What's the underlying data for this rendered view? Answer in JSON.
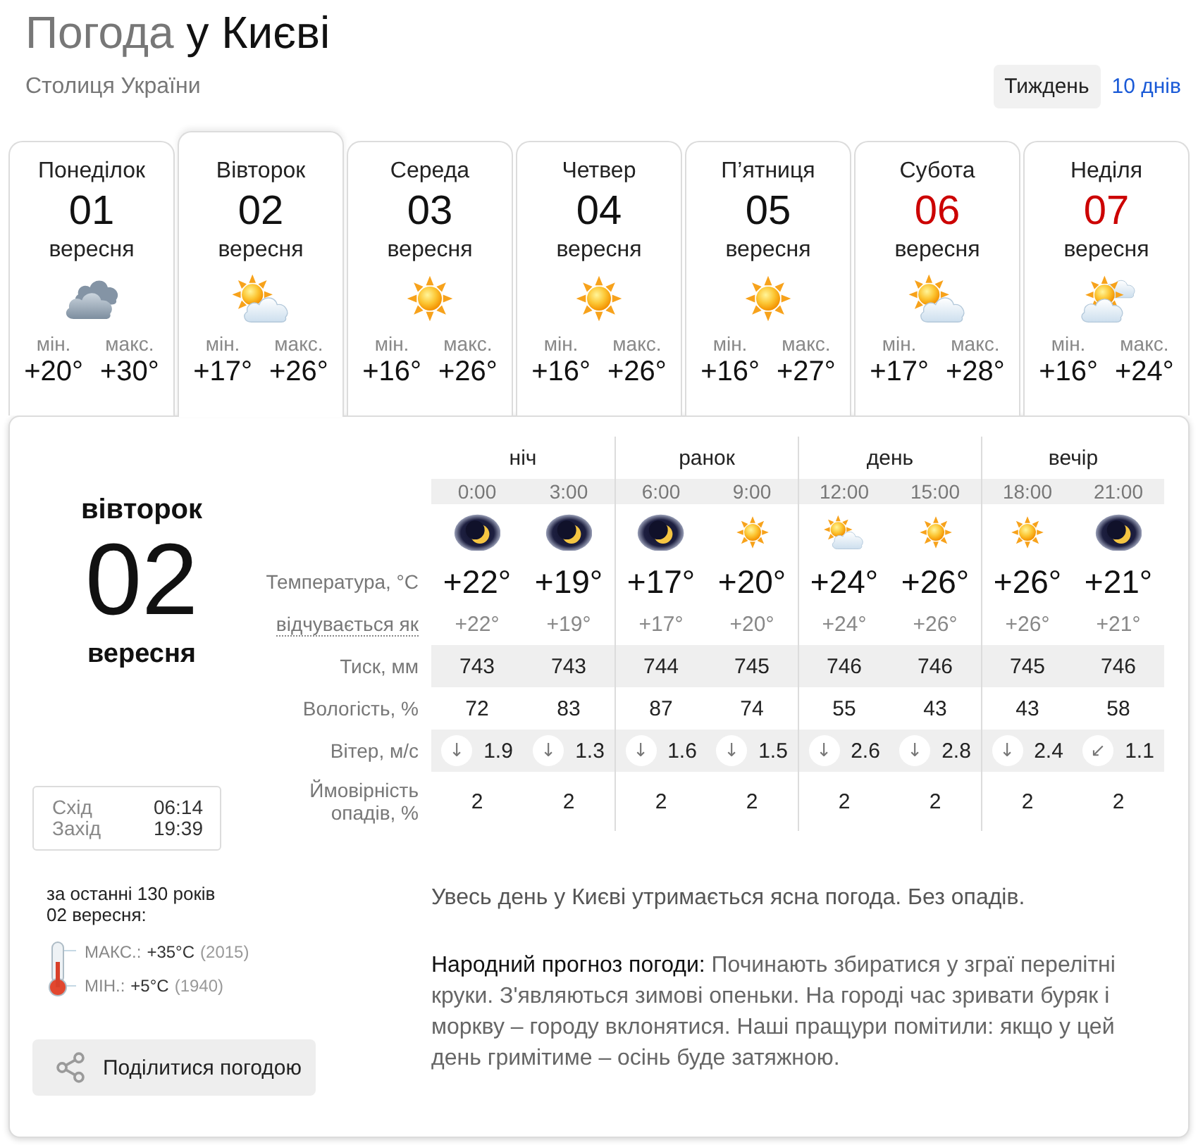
{
  "header": {
    "title_muted": "Погода",
    "title": "у Києві",
    "subtitle": "Столиця України",
    "views": [
      {
        "label": "Тиждень",
        "selected": true
      },
      {
        "label": "10 днів",
        "selected": false
      }
    ]
  },
  "days": [
    {
      "weekday": "Понеділок",
      "date": "01",
      "month": "вересня",
      "kind": "cloudy",
      "weekend": false,
      "selected": false,
      "min_label": "мін.",
      "min": "+20°",
      "max_label": "макс.",
      "max": "+30°"
    },
    {
      "weekday": "Вівторок",
      "date": "02",
      "month": "вересня",
      "kind": "partly-cloudy",
      "weekend": false,
      "selected": true,
      "min_label": "мін.",
      "min": "+17°",
      "max_label": "макс.",
      "max": "+26°"
    },
    {
      "weekday": "Середа",
      "date": "03",
      "month": "вересня",
      "kind": "sunny",
      "weekend": false,
      "selected": false,
      "min_label": "мін.",
      "min": "+16°",
      "max_label": "макс.",
      "max": "+26°"
    },
    {
      "weekday": "Четвер",
      "date": "04",
      "month": "вересня",
      "kind": "sunny",
      "weekend": false,
      "selected": false,
      "min_label": "мін.",
      "min": "+16°",
      "max_label": "макс.",
      "max": "+26°"
    },
    {
      "weekday": "П’ятниця",
      "date": "05",
      "month": "вересня",
      "kind": "sunny",
      "weekend": false,
      "selected": false,
      "min_label": "мін.",
      "min": "+16°",
      "max_label": "макс.",
      "max": "+27°"
    },
    {
      "weekday": "Субота",
      "date": "06",
      "month": "вересня",
      "kind": "partly-cloudy",
      "weekend": true,
      "selected": false,
      "min_label": "мін.",
      "min": "+17°",
      "max_label": "макс.",
      "max": "+28°"
    },
    {
      "weekday": "Неділя",
      "date": "07",
      "month": "вересня",
      "kind": "variable-cloudy",
      "weekend": true,
      "selected": false,
      "min_label": "мін.",
      "min": "+16°",
      "max_label": "макс.",
      "max": "+24°"
    }
  ],
  "detail": {
    "weekday": "вівторок",
    "date": "02",
    "month": "вересня",
    "sun": [
      {
        "label": "Схід",
        "time": "06:14"
      },
      {
        "label": "Захід",
        "time": "19:39"
      }
    ],
    "records": {
      "period": "за останні 130 років",
      "date": "02 вересня:",
      "rows": [
        {
          "label": "МАКС.:",
          "value": "+35°C",
          "year": "(2015)"
        },
        {
          "label": "МІН.:",
          "value": "+5°C",
          "year": "(1940)"
        }
      ]
    },
    "share_button": "Поділитися погодою"
  },
  "hourly": {
    "periods": [
      "ніч",
      "ранок",
      "день",
      "вечір"
    ],
    "labels": {
      "temperature": "Температура, °C",
      "feels_like": "відчувається як",
      "pressure": "Тиск, мм",
      "humidity": "Вологість, %",
      "wind": "Вітер, м/с",
      "precipitation": "Ймовірність опадів, %"
    },
    "hours": [
      {
        "time": "0:00",
        "kind": "night-clear",
        "temperature": "+22°",
        "feels_like": "+22°",
        "pressure": "743",
        "humidity": "72",
        "wind_arrow": "↓",
        "wind": "1.9",
        "precipitation": "2"
      },
      {
        "time": "3:00",
        "kind": "night-clear",
        "temperature": "+19°",
        "feels_like": "+19°",
        "pressure": "743",
        "humidity": "83",
        "wind_arrow": "↓",
        "wind": "1.3",
        "precipitation": "2"
      },
      {
        "time": "6:00",
        "kind": "night-clear",
        "temperature": "+17°",
        "feels_like": "+17°",
        "pressure": "744",
        "humidity": "87",
        "wind_arrow": "↓",
        "wind": "1.6",
        "precipitation": "2"
      },
      {
        "time": "9:00",
        "kind": "sunny",
        "temperature": "+20°",
        "feels_like": "+20°",
        "pressure": "745",
        "humidity": "74",
        "wind_arrow": "↓",
        "wind": "1.5",
        "precipitation": "2"
      },
      {
        "time": "12:00",
        "kind": "partly-cloudy",
        "temperature": "+24°",
        "feels_like": "+24°",
        "pressure": "746",
        "humidity": "55",
        "wind_arrow": "↓",
        "wind": "2.6",
        "precipitation": "2"
      },
      {
        "time": "15:00",
        "kind": "sunny",
        "temperature": "+26°",
        "feels_like": "+26°",
        "pressure": "746",
        "humidity": "43",
        "wind_arrow": "↓",
        "wind": "2.8",
        "precipitation": "2"
      },
      {
        "time": "18:00",
        "kind": "sunny",
        "temperature": "+26°",
        "feels_like": "+26°",
        "pressure": "745",
        "humidity": "43",
        "wind_arrow": "↓",
        "wind": "2.4",
        "precipitation": "2"
      },
      {
        "time": "21:00",
        "kind": "night-clear",
        "temperature": "+21°",
        "feels_like": "+21°",
        "pressure": "746",
        "humidity": "58",
        "wind_arrow": "↙",
        "wind": "1.1",
        "precipitation": "2"
      }
    ]
  },
  "summary": "Увесь день у Києві утримається ясна погода. Без опадів.",
  "folk_forecast": {
    "label": "Народний прогноз погоди:",
    "text": "Починають збиратися у зграї перелітні круки. З'являються зимові опеньки. На городі час зривати буряк і моркву – городу вклонятися. Наші пращури помітили: якщо у цей день гримітиме – осінь буде затяжною."
  }
}
